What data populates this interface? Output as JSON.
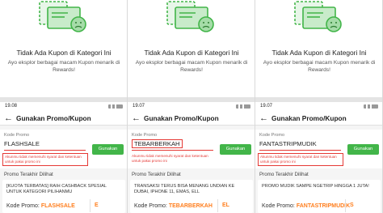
{
  "colors": {
    "green": "#42b549",
    "red": "#e53935",
    "orange": "#ff7e1d"
  },
  "panels": [
    {
      "empty_title": "Tidak Ada Kupon di Kategori Ini",
      "empty_desc": "Ayo eksplor berbagai macam Kupon menarik di Rewards!",
      "status_time": "19.08",
      "header_title": "Gunakan Promo/Kupon",
      "field_label": "Kode Promo",
      "field_value": "FLASHSALE",
      "apply_label": "Gunakan",
      "error": "Akunmu tidak memenuhi syarat dan ketentuan untuk pakai promo ini",
      "recent_label": "Promo Terakhir Dilihat",
      "promo_text": "[KUOTA TERBATAS] RAIH CASHBACK SPESIAL UNTUK KATEGORI PILIHANMU",
      "promo_code_label": "Kode Promo:",
      "promo_code": "FLASHSALE",
      "promo_more": "E"
    },
    {
      "empty_title": "Tidak Ada Kupon di Kategori Ini",
      "empty_desc": "Ayo eksplor berbagai macam Kupon menarik di Rewards!",
      "status_time": "19.07",
      "header_title": "Gunakan Promo/Kupon",
      "field_label": "Kode Promo",
      "field_value": "TEBARBERKAH",
      "apply_label": "Gunakan",
      "error": "Akunmu tidak memenuhi syarat dan ketentuan untuk pakai promo ini",
      "recent_label": "Promo Terakhir Dilihat",
      "promo_text": "TRANSAKSI TERUS BISA MENANG UNDIAN KE DUBAI, IPHONE 11, EMAS, ELL",
      "promo_code_label": "Kode Promo:",
      "promo_code": "TEBARBERKAH",
      "promo_more": "EL"
    },
    {
      "empty_title": "Tidak Ada Kupon di Kategori Ini",
      "empty_desc": "Ayo eksplor berbagai macam Kupon menarik di Rewards!",
      "status_time": "19.07",
      "header_title": "Gunakan Promo/Kupon",
      "field_label": "Kode Promo",
      "field_value": "FANTASTRIPMUDIK",
      "apply_label": "Gunakan",
      "error": "Akunmu tidak memenuhi syarat dan ketentuan untuk pakai promo ini",
      "recent_label": "Promo Terakhir Dilihat",
      "promo_text": "PROMO MUDIK SAMPE NGETRIP HINGGA 1 JUTA!",
      "promo_code_label": "Kode Promo:",
      "promo_code": "FANTASTRIPMUDIK",
      "promo_more": "S"
    }
  ]
}
